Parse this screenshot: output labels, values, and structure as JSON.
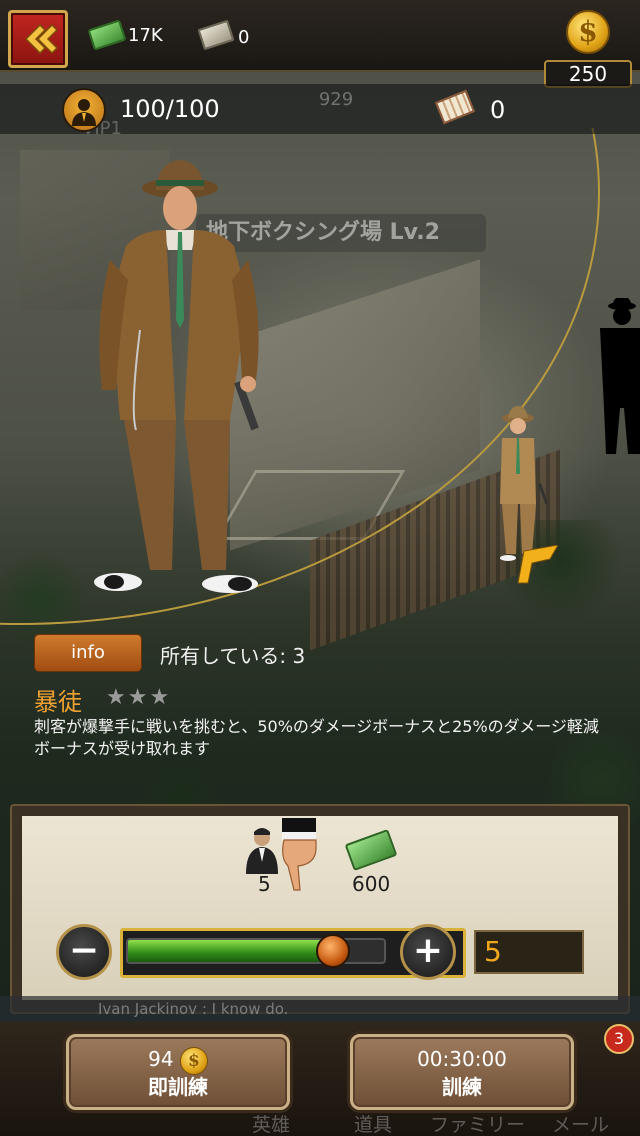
{
  "header": {
    "cash": "17K",
    "paper": "0",
    "gold": "250",
    "stamina": "100/100",
    "ghost_counter": "929",
    "ghost_vip": "VIP1",
    "tickets": "0"
  },
  "scene": {
    "building_label": "地下ボクシング場 Lv.2"
  },
  "hero": {
    "info_label": "info",
    "owned": "所有している: 3",
    "skill_name": "暴徒",
    "stars": "★★★",
    "skill_description": "刺客が爆撃手に戦いを挑むと、50%のダメージボーナスと25%のダメージ軽減ボーナスが受け取れます"
  },
  "training": {
    "unit_count": "5",
    "money_cost": "600",
    "quantity": "5",
    "slider_fraction": 0.8
  },
  "chat": {
    "line": "Ivan Jackinov : I know do."
  },
  "actions": {
    "instant_cost": "94",
    "instant_label": "即訓練",
    "train_time": "00:30:00",
    "train_label": "訓練"
  },
  "nav": {
    "badge": "3",
    "items": [
      "英雄",
      "道具",
      "ファミリー",
      "メール"
    ]
  },
  "colors": {
    "accent_orange": "#f0a132",
    "gold": "#d9b23a",
    "back_red": "#c22620"
  }
}
